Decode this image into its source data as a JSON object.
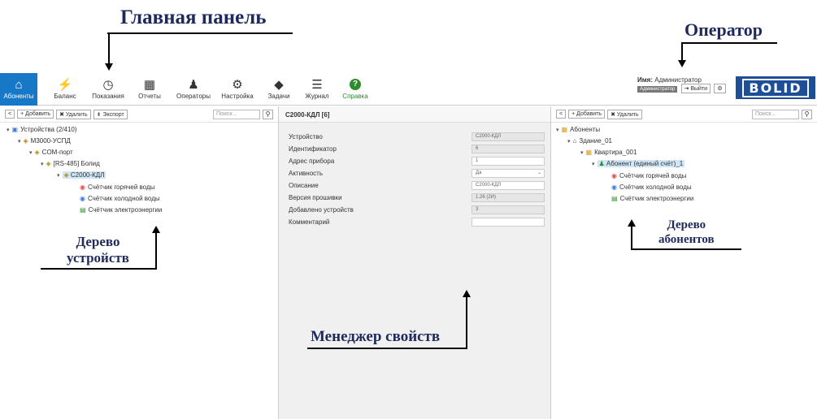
{
  "annotations": {
    "main_panel": "Главная панель",
    "operator": "Оператор",
    "device_tree_1": "Дерево",
    "device_tree_2": "устройств",
    "subscriber_tree_1": "Дерево",
    "subscriber_tree_2": "абонентов",
    "property_manager": "Менеджер свойств"
  },
  "nav": [
    {
      "label": "Абоненты",
      "icon": "home-icon",
      "glyph": "⌂"
    },
    {
      "label": "Баланс",
      "icon": "lightning-icon",
      "glyph": "⚡"
    },
    {
      "label": "Показания",
      "icon": "gauge-icon",
      "glyph": "◷"
    },
    {
      "label": "Отчеты",
      "icon": "calendar-icon",
      "glyph": "▦"
    },
    {
      "label": "Операторы",
      "icon": "user-icon",
      "glyph": "♟"
    },
    {
      "label": "Настройка",
      "icon": "gear-icon",
      "glyph": "⚙"
    },
    {
      "label": "Задачи",
      "icon": "tags-icon",
      "glyph": "◆"
    },
    {
      "label": "Журнал",
      "icon": "journal-icon",
      "glyph": "☰"
    },
    {
      "label": "Справка",
      "icon": "help-icon",
      "glyph": "?"
    }
  ],
  "user": {
    "name_label": "Имя:",
    "name_value": "Администратор",
    "role": "Администратор",
    "logout": "Выйти",
    "logout_glyph": "⇥",
    "settings_glyph": "⚙"
  },
  "logo_text": "BOLID",
  "left": {
    "back": "<",
    "add": "+ Добавить",
    "delete": "✖ Удалить",
    "export": "⇟ Экспорт",
    "search_placeholder": "Поиск...",
    "search_glyph": "⚲",
    "tree": {
      "root": "Устройства (2/410)",
      "uspd": "М3000-УСПД",
      "com": "COM-порт",
      "rs485": "[RS-485] Болид",
      "kdl": "С2000-КДЛ",
      "hot": "Счётчик горячей воды",
      "cold": "Счётчик холодной воды",
      "elec": "Счётчик электроэнергии"
    }
  },
  "mid": {
    "title": "С2000-КДЛ [6]",
    "props": [
      {
        "label": "Устройство",
        "value": "С2000-КДЛ",
        "readonly": true
      },
      {
        "label": "Идентификатор",
        "value": "6",
        "readonly": true
      },
      {
        "label": "Адрес прибора",
        "value": "1",
        "readonly": false
      },
      {
        "label": "Активность",
        "value": "Да",
        "readonly": false,
        "select": true
      },
      {
        "label": "Описание",
        "value": "С2000-КДЛ",
        "readonly": false
      },
      {
        "label": "Версия прошивки",
        "value": "1.26 (2И)",
        "readonly": true
      },
      {
        "label": "Добавлено устройств",
        "value": "3",
        "readonly": true
      },
      {
        "label": "Комментарий",
        "value": "",
        "readonly": false
      }
    ]
  },
  "right": {
    "back": "<",
    "add": "+ Добавить",
    "delete": "✖ Удалить",
    "search_placeholder": "Поиск...",
    "search_glyph": "⚲",
    "tree": {
      "root": "Абоненты",
      "building": "Здание_01",
      "flat": "Квартира_001",
      "subscriber": "Абонент (единый счёт)_1",
      "hot": "Счётчик горячей воды",
      "cold": "Счётчик холодной воды",
      "elec": "Счётчик электроэнергии"
    }
  },
  "colors": {
    "accent": "#1778c8",
    "logo": "#1e4f96",
    "annotation": "#1f2a5c"
  }
}
